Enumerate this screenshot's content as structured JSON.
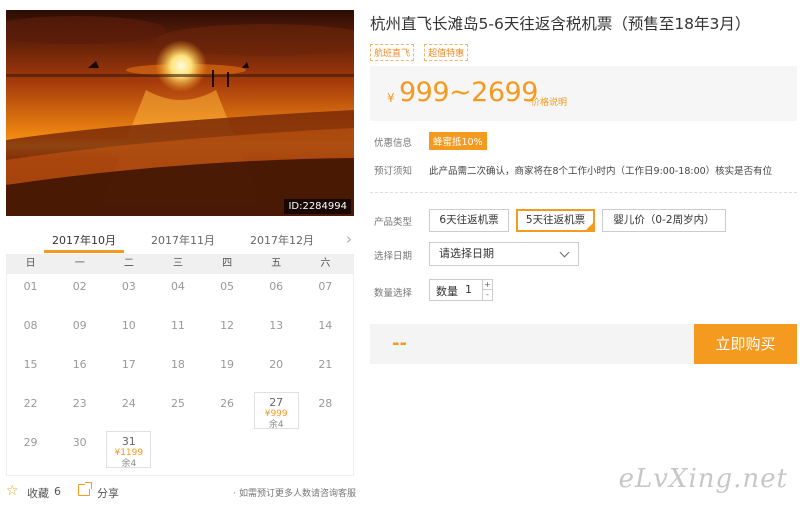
{
  "product": {
    "photo_id": "ID:2284994",
    "title": "杭州直飞长滩岛5-6天往返含税机票（预售至18年3月）",
    "tags": [
      "航班直飞",
      "超值特惠"
    ]
  },
  "price": {
    "currency": "¥",
    "range": "999~2699",
    "note": "价格说明"
  },
  "info": {
    "promo_label": "优惠信息",
    "promo_badge": "蜂蜜抵10%",
    "notice_label": "预订须知",
    "notice_text": "此产品需二次确认，商家将在8个工作小时内（工作日9:00-18:00）核实是否有位"
  },
  "options": {
    "type_label": "产品类型",
    "types": [
      "6天往返机票",
      "5天往返机票",
      "婴儿价（0-2周岁内）"
    ],
    "selected_type": "5天往返机票",
    "date_label": "选择日期",
    "date_placeholder": "请选择日期",
    "qty_label": "数量选择",
    "qty_text": "数量",
    "qty_value": "1",
    "qty_up": "+",
    "qty_down": "-"
  },
  "purchase": {
    "total": "--",
    "buy_label": "立即购买"
  },
  "calendar": {
    "months": [
      "2017年10月",
      "2017年11月",
      "2017年12月"
    ],
    "active_month": "2017年10月",
    "next_icon": "chevron-right-icon",
    "weekdays": [
      "日",
      "一",
      "二",
      "三",
      "四",
      "五",
      "六"
    ],
    "weeks": [
      [
        {
          "d": "01"
        },
        {
          "d": "02"
        },
        {
          "d": "03"
        },
        {
          "d": "04"
        },
        {
          "d": "05"
        },
        {
          "d": "06"
        },
        {
          "d": "07"
        }
      ],
      [
        {
          "d": "08"
        },
        {
          "d": "09"
        },
        {
          "d": "10"
        },
        {
          "d": "11"
        },
        {
          "d": "12"
        },
        {
          "d": "13"
        },
        {
          "d": "14"
        }
      ],
      [
        {
          "d": "15"
        },
        {
          "d": "16"
        },
        {
          "d": "17"
        },
        {
          "d": "18"
        },
        {
          "d": "19"
        },
        {
          "d": "20"
        },
        {
          "d": "21"
        }
      ],
      [
        {
          "d": "22"
        },
        {
          "d": "23"
        },
        {
          "d": "24"
        },
        {
          "d": "25"
        },
        {
          "d": "26"
        },
        {
          "d": "27",
          "price": "¥999",
          "remain": "余4"
        },
        {
          "d": "28"
        }
      ],
      [
        {
          "d": "29"
        },
        {
          "d": "30"
        },
        {
          "d": "31",
          "price": "¥1199",
          "remain": "余4"
        }
      ]
    ]
  },
  "social": {
    "fav_label": "收藏",
    "fav_count": "6",
    "share_label": "分享",
    "note": "· 如需预订更多人数请咨询客服"
  },
  "watermark": "eLvXing.net",
  "colors": {
    "accent": "#f39a1f"
  }
}
